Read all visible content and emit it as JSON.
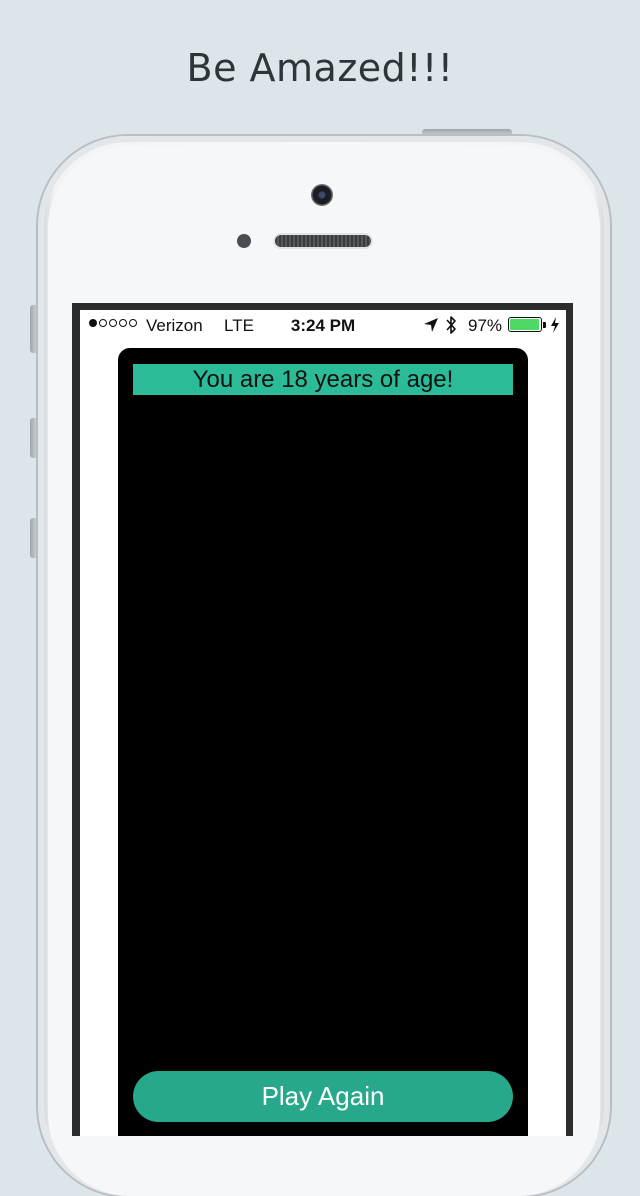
{
  "headline": "Be Amazed!!!",
  "status_bar": {
    "carrier": "Verizon",
    "network": "LTE",
    "time": "3:24 PM",
    "battery_percent": "97%",
    "battery_level": 0.97,
    "signal_bars": 1,
    "signal_total": 5,
    "icons": [
      "location-arrow-icon",
      "bluetooth-icon",
      "battery-icon",
      "charging-bolt-icon"
    ]
  },
  "app": {
    "result_text": "You are 18 years of age!",
    "play_again_label": "Play Again",
    "colors": {
      "banner": "#2cbb97",
      "button": "#27a88a",
      "card": "#000000"
    }
  }
}
